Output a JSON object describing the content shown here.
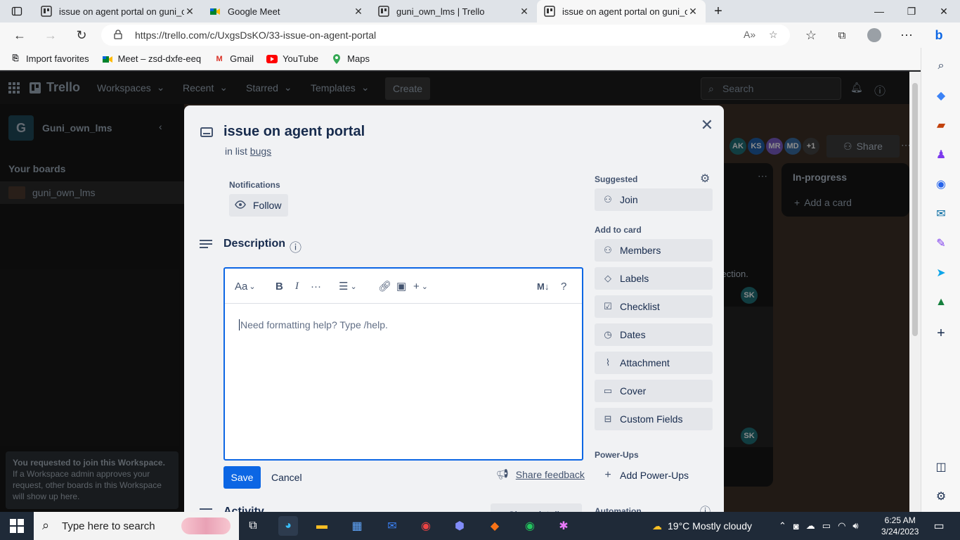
{
  "browser": {
    "tabs": [
      {
        "title": "issue on agent portal on guni_ow",
        "active": false
      },
      {
        "title": "Google Meet",
        "active": false
      },
      {
        "title": "guni_own_lms | Trello",
        "active": false
      },
      {
        "title": "issue on agent portal on guni_ow",
        "active": true
      }
    ],
    "url": "https://trello.com/c/UxgsDsKO/33-issue-on-agent-portal",
    "favorites": [
      {
        "label": "Import favorites",
        "icon": "import-icon"
      },
      {
        "label": "Meet – zsd-dxfe-eeq",
        "icon": "meet-icon"
      },
      {
        "label": "Gmail",
        "icon": "gmail-icon"
      },
      {
        "label": "YouTube",
        "icon": "youtube-icon"
      },
      {
        "label": "Maps",
        "icon": "maps-icon"
      }
    ]
  },
  "trello": {
    "logo": "Trello",
    "nav": [
      "Workspaces",
      "Recent",
      "Starred",
      "Templates"
    ],
    "create": "Create",
    "search_placeholder": "Search",
    "workspace_initial": "G",
    "workspace_name": "Guni_own_lms",
    "your_boards": "Your boards",
    "board_name": "guni_own_lms",
    "join_notice_bold": "You requested to join this Workspace.",
    "join_notice_rest": " If a Workspace admin approves your request, other boards in this Workspace will show up here.",
    "members": [
      "AK",
      "KS",
      "MR",
      "MD"
    ],
    "members_more": "+1",
    "share": "Share",
    "list_inprogress": "In-progress",
    "add_card": "Add a card",
    "card_fragment": "t\nsection.",
    "member_sk": "SK"
  },
  "card": {
    "title": "issue on agent portal",
    "in_list_prefix": "in list",
    "list_name": "bugs",
    "notifications_label": "Notifications",
    "follow": "Follow",
    "description_title": "Description",
    "editor_placeholder": "Need formatting help? Type /help.",
    "toolbar": {
      "text_style": "Aa",
      "bold": "B",
      "italic": "I",
      "more": "···",
      "markdown": "M↓",
      "help": "?"
    },
    "save": "Save",
    "cancel": "Cancel",
    "share_feedback": "Share feedback",
    "activity": "Activity",
    "show_details": "Show details",
    "suggested": "Suggested",
    "join": "Join",
    "add_to_card": "Add to card",
    "add_to_card_items": [
      {
        "label": "Members",
        "icon": "person-icon"
      },
      {
        "label": "Labels",
        "icon": "tag-icon"
      },
      {
        "label": "Checklist",
        "icon": "checklist-icon"
      },
      {
        "label": "Dates",
        "icon": "clock-icon"
      },
      {
        "label": "Attachment",
        "icon": "paperclip-icon"
      },
      {
        "label": "Cover",
        "icon": "cover-icon"
      },
      {
        "label": "Custom Fields",
        "icon": "custom-fields-icon"
      }
    ],
    "power_ups": "Power-Ups",
    "add_power_ups": "Add Power-Ups",
    "automation": "Automation"
  },
  "taskbar": {
    "search_placeholder": "Type here to search",
    "weather": "19°C  Mostly cloudy",
    "time": "6:25 AM",
    "date": "3/24/2023"
  },
  "colors": {
    "accent": "#0c66e4",
    "modal_bg": "#f1f2f4",
    "topnav_bg": "#1d1d1d"
  }
}
